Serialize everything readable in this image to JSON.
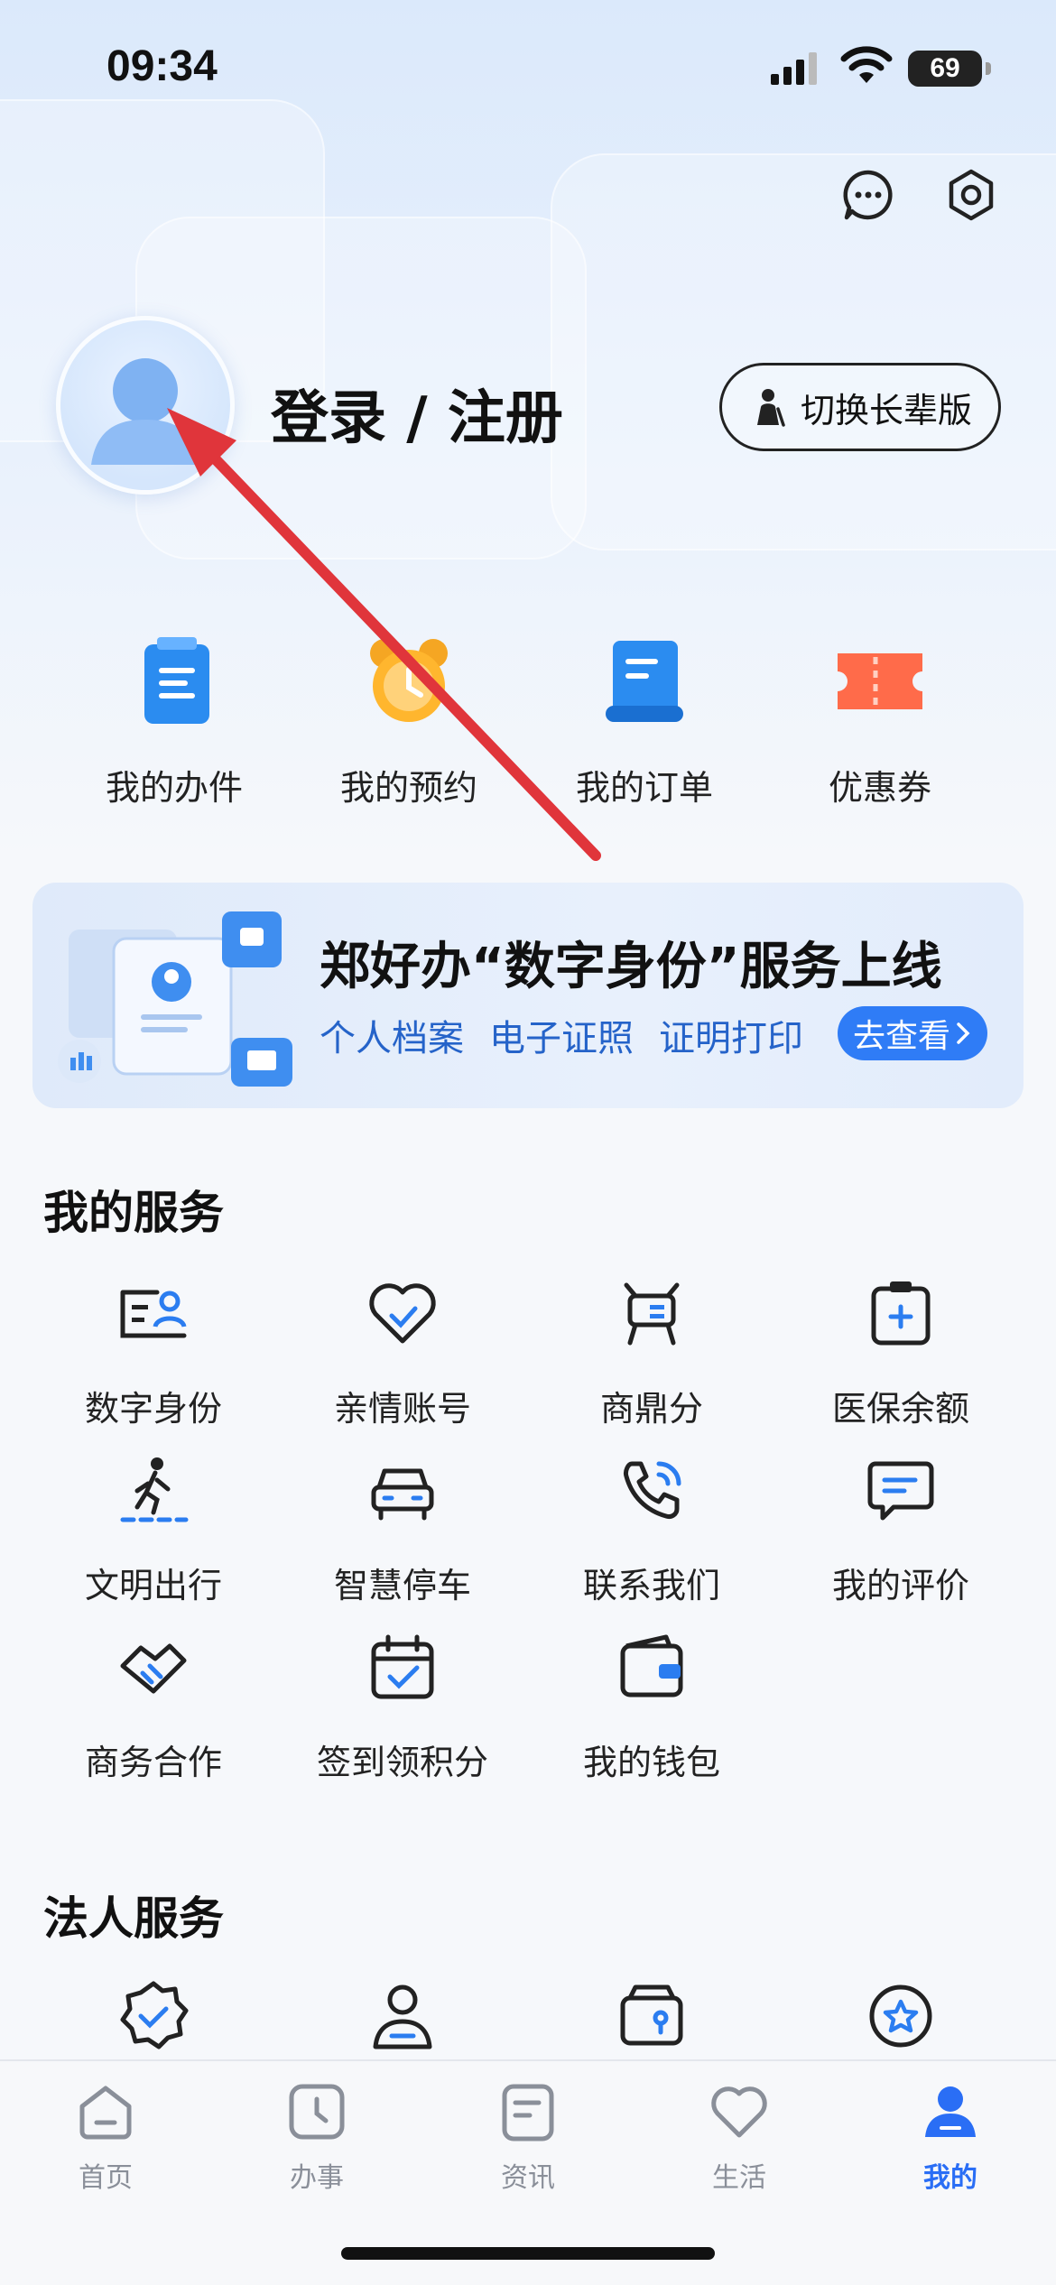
{
  "status_bar": {
    "time": "09:34",
    "battery": "69"
  },
  "profile": {
    "login_label": "登录 / 注册",
    "elder_mode_label": "切换长辈版"
  },
  "quick_actions": [
    {
      "label": "我的办件",
      "icon": "document-icon"
    },
    {
      "label": "我的预约",
      "icon": "alarm-clock-icon"
    },
    {
      "label": "我的订单",
      "icon": "order-scroll-icon"
    },
    {
      "label": "优惠券",
      "icon": "coupon-ticket-icon"
    }
  ],
  "banner": {
    "title": "郑好办“数字身份”服务上线",
    "links": [
      "个人档案",
      "电子证照",
      "证明打印"
    ],
    "cta": "去查看"
  },
  "my_services": {
    "title": "我的服务",
    "items": [
      {
        "label": "数字身份",
        "icon": "digital-id-icon"
      },
      {
        "label": "亲情账号",
        "icon": "family-heart-icon"
      },
      {
        "label": "商鼎分",
        "icon": "tripod-icon"
      },
      {
        "label": "医保余额",
        "icon": "medical-insurance-icon"
      },
      {
        "label": "文明出行",
        "icon": "pedestrian-icon"
      },
      {
        "label": "智慧停车",
        "icon": "car-icon"
      },
      {
        "label": "联系我们",
        "icon": "phone-icon"
      },
      {
        "label": "我的评价",
        "icon": "comment-icon"
      },
      {
        "label": "商务合作",
        "icon": "handshake-icon"
      },
      {
        "label": "签到领积分",
        "icon": "calendar-check-icon"
      },
      {
        "label": "我的钱包",
        "icon": "wallet-icon"
      }
    ]
  },
  "legal_services": {
    "title": "法人服务"
  },
  "tabbar": [
    {
      "label": "首页",
      "icon": "home-icon",
      "active": false
    },
    {
      "label": "办事",
      "icon": "clock-icon",
      "active": false
    },
    {
      "label": "资讯",
      "icon": "news-icon",
      "active": false
    },
    {
      "label": "生活",
      "icon": "heart-icon",
      "active": false
    },
    {
      "label": "我的",
      "icon": "user-icon",
      "active": true
    }
  ],
  "colors": {
    "accent": "#2a6ef5",
    "arrow": "#e0353b",
    "text": "#1b1f2a"
  }
}
